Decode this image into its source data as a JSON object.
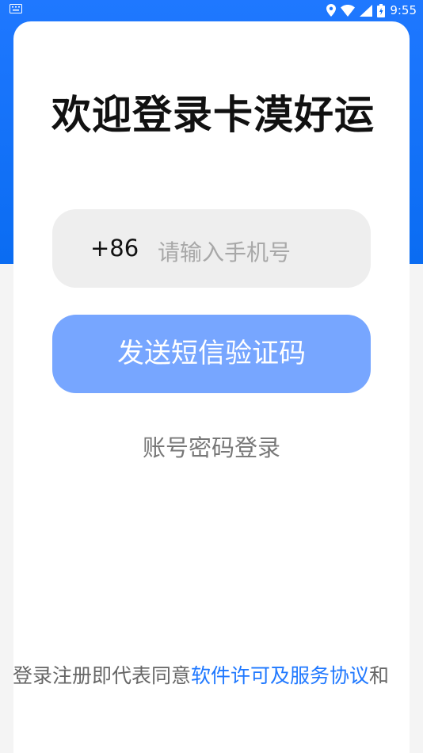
{
  "status_bar": {
    "keyboard_icon": "keyboard-icon",
    "location_icon": "location-icon",
    "wifi_icon": "wifi-icon",
    "signal_icon": "signal-icon",
    "battery_icon": "battery-icon",
    "time": "9:55"
  },
  "header": {
    "title": "欢迎登录卡漠好运"
  },
  "form": {
    "country_code": "+86",
    "phone_placeholder": "请输入手机号",
    "sms_button_label": "发送短信验证码",
    "password_login_label": "账号密码登录"
  },
  "agreement": {
    "prefix": "登录注册即代表同意",
    "link_text": "软件许可及服务协议",
    "suffix": "和"
  },
  "colors": {
    "accent": "#1f78ff",
    "button": "#77a6ff",
    "input_bg": "#eeeeee"
  }
}
